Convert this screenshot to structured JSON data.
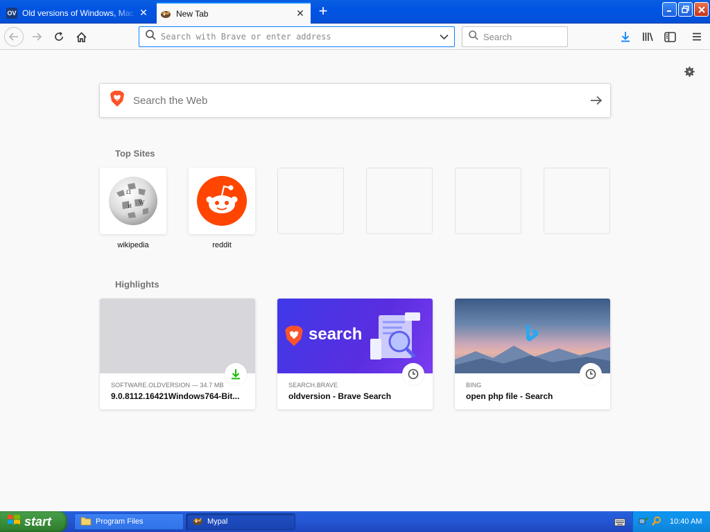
{
  "tabs": [
    {
      "title": "Old versions of Windows, Mac and Linux software",
      "favicon": "ov",
      "active": false
    },
    {
      "title": "New Tab",
      "favicon": "mypal-icon",
      "active": true
    }
  ],
  "toolbar": {
    "url_placeholder": "Search with Brave or enter address",
    "search_placeholder": "Search"
  },
  "newtab": {
    "websearch_placeholder": "Search the Web",
    "topsites_title": "Top Sites",
    "topsites": [
      {
        "label": "wikipedia",
        "icon": "wikipedia-globe-icon"
      },
      {
        "label": "reddit",
        "icon": "reddit-icon"
      },
      {
        "label": ""
      },
      {
        "label": ""
      },
      {
        "label": ""
      },
      {
        "label": ""
      }
    ],
    "highlights_title": "Highlights",
    "highlights": [
      {
        "source": "SOFTWARE.OLDVERSION — 34.7 MB",
        "title": "9.0.8112.16421Windows764-Bit...",
        "badge": "download-icon"
      },
      {
        "source": "SEARCH.BRAVE",
        "title": "oldversion - Brave Search",
        "badge": "clock-icon",
        "thumb_text": "search"
      },
      {
        "source": "BING",
        "title": "open php file - Search",
        "badge": "clock-icon"
      }
    ]
  },
  "taskbar": {
    "start_label": "start",
    "tasks": [
      {
        "label": "Program Files",
        "icon": "folder-icon"
      },
      {
        "label": "Mypal",
        "icon": "mypal-icon"
      }
    ],
    "clock": "10:40 AM"
  },
  "colors": {
    "accent": "#0a84ff",
    "xp_blue": "#0054e3",
    "brave_orange": "#fb542b",
    "reddit_orange": "#ff4500",
    "download_green": "#12bc00"
  }
}
